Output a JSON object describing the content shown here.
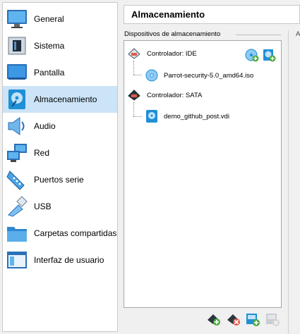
{
  "sidebar": {
    "items": [
      {
        "label": "General",
        "icon": "general-monitor-icon"
      },
      {
        "label": "Sistema",
        "icon": "chip-icon"
      },
      {
        "label": "Pantalla",
        "icon": "display-icon"
      },
      {
        "label": "Almacenamiento",
        "icon": "storage-disk-icon"
      },
      {
        "label": "Audio",
        "icon": "speaker-icon"
      },
      {
        "label": "Red",
        "icon": "network-icon"
      },
      {
        "label": "Puertos serie",
        "icon": "serial-port-icon"
      },
      {
        "label": "USB",
        "icon": "usb-icon"
      },
      {
        "label": "Carpetas compartidas",
        "icon": "folder-icon"
      },
      {
        "label": "Interfaz de usuario",
        "icon": "ui-window-icon"
      }
    ],
    "selected_index": 3
  },
  "header": {
    "title": "Almacenamiento"
  },
  "storage": {
    "section_label": "Dispositivos de almacenamiento",
    "controllers": [
      {
        "name": "Controlador: IDE",
        "device": "Parrot-security-5.0_amd64.iso"
      },
      {
        "name": "Controlador: SATA",
        "device": "demo_github_post.vdi"
      }
    ]
  },
  "right_fragment": "A",
  "colors": {
    "selected_bg": "#cce4f7",
    "accent_blue": "#1f8fd6",
    "add_green": "#4caa3c"
  }
}
